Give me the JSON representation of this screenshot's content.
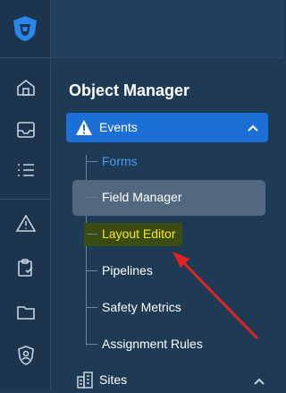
{
  "rail": {
    "logo_icon": "shield-logo-icon",
    "icons": [
      "home-icon",
      "inbox-icon",
      "list-icon",
      "hazard-icon",
      "clipboard-check-icon",
      "folder-icon",
      "user-shield-icon"
    ]
  },
  "panel": {
    "title": "Object Manager",
    "section": {
      "label": "Events",
      "icon": "warning-icon",
      "expanded": true
    },
    "items": [
      {
        "label": "Forms"
      },
      {
        "label": "Field Manager"
      },
      {
        "label": "Layout Editor"
      },
      {
        "label": "Pipelines"
      },
      {
        "label": "Safety Metrics"
      },
      {
        "label": "Assignment Rules"
      }
    ],
    "sites": {
      "label": "Sites",
      "icon": "buildings-icon"
    }
  },
  "colors": {
    "accent": "#1d6fd8",
    "link": "#4b9cf2",
    "highlight_text": "#f7e91f",
    "annotation_arrow": "#e02424"
  }
}
